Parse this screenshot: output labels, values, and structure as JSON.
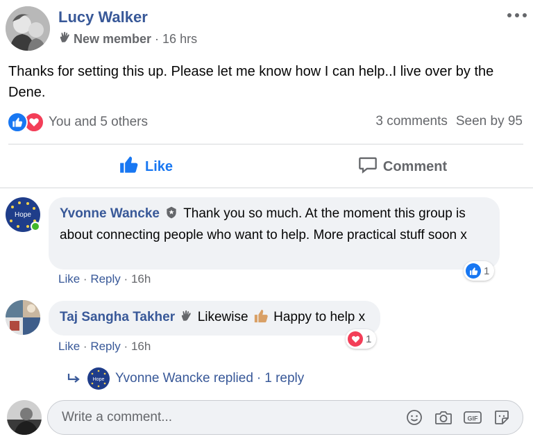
{
  "post": {
    "author": "Lucy Walker",
    "badge": "New member",
    "separator": "·",
    "time": "16 hrs",
    "text": "Thanks for setting this up. Please let me know how I can help..I live over by the Dene.",
    "reaction_summary": "You and 5 others",
    "comments_count": "3 comments",
    "seen_by": "Seen by 95"
  },
  "actions": {
    "like_label": "Like",
    "comment_label": "Comment"
  },
  "comments": [
    {
      "author": "Yvonne Wancke",
      "avatar_text": "Hope",
      "text": "Thank you so much. At the moment this group is about connecting people who want to help. More practical stuff soon x",
      "like_label": "Like",
      "reply_label": "Reply",
      "dot": "·",
      "time": "16h",
      "reaction_count": "1",
      "reaction_icon": "like-icon"
    },
    {
      "author": "Taj Sangha Takher",
      "text_before": "Likewise",
      "text_after": "Happy to help x",
      "like_label": "Like",
      "reply_label": "Reply",
      "dot": "·",
      "time": "16h",
      "reaction_count": "1",
      "reaction_icon": "love-icon"
    }
  ],
  "reply_summary": {
    "avatar_text": "Hope",
    "text": "Yvonne Wancke replied",
    "dot": "·",
    "count": "1 reply"
  },
  "composer": {
    "placeholder": "Write a comment..."
  },
  "colors": {
    "link": "#385898",
    "like_blue": "#1877f2",
    "love_red": "#f33e58",
    "muted": "#65676b",
    "bubble": "#f0f2f5"
  }
}
